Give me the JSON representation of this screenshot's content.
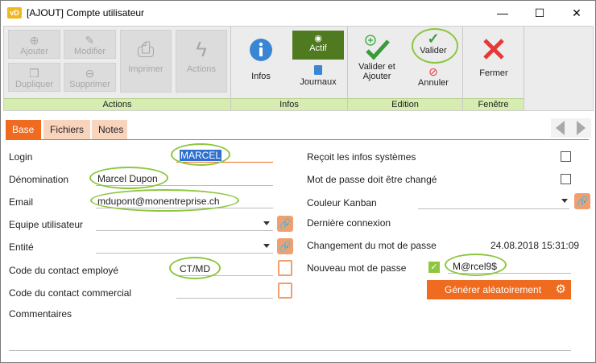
{
  "window": {
    "app_icon": "vD",
    "title": "[AJOUT] Compte utilisateur",
    "min_glyph": "—",
    "max_glyph": "☐",
    "close_glyph": "✕"
  },
  "ribbon": {
    "groups": {
      "actions": "Actions",
      "infos": "Infos",
      "edition": "Edition",
      "fenetre": "Fenêtre"
    },
    "buttons": {
      "ajouter": "Ajouter",
      "modifier": "Modifier",
      "dupliquer": "Dupliquer",
      "supprimer": "Supprimer",
      "imprimer": "Imprimer",
      "actions": "Actions",
      "infos": "Infos",
      "actif": "Actif",
      "journaux": "Journaux",
      "valider_et": "Valider et",
      "ajouter2": "Ajouter",
      "valider": "Valider",
      "annuler": "Annuler",
      "fermer": "Fermer"
    },
    "colors": {
      "footer": "#d6ecb1",
      "actif": "#4f7a1f",
      "valider": "#4caf50",
      "close": "#e53935"
    }
  },
  "tabs": [
    "Base",
    "Fichiers",
    "Notes"
  ],
  "form_left": {
    "login": {
      "label": "Login",
      "value": "MARCEL"
    },
    "denomination": {
      "label": "Dénomination",
      "value": "Marcel Dupon"
    },
    "email": {
      "label": "Email",
      "value": "mdupont@monentreprise.ch"
    },
    "equipe": {
      "label": "Equipe utilisateur",
      "value": ""
    },
    "entite": {
      "label": "Entité",
      "value": ""
    },
    "code_employe": {
      "label": "Code du contact employé",
      "value": "CT/MD"
    },
    "code_commercial": {
      "label": "Code du contact commercial",
      "value": ""
    },
    "commentaires": {
      "label": "Commentaires"
    }
  },
  "form_right": {
    "infos_systemes": {
      "label": "Reçoit les infos systèmes",
      "checked": false
    },
    "mdp_change": {
      "label": "Mot de passe doit être changé",
      "checked": false
    },
    "couleur": {
      "label": "Couleur Kanban",
      "value": ""
    },
    "derniere": {
      "label": "Dernière connexion",
      "value": ""
    },
    "changement": {
      "label": "Changement du mot de passe",
      "value": "24.08.2018 15:31:09"
    },
    "nouveau": {
      "label": "Nouveau mot de passe",
      "value": "M@rcel9$",
      "checked": true
    },
    "generer": "Générer aléatoirement"
  }
}
